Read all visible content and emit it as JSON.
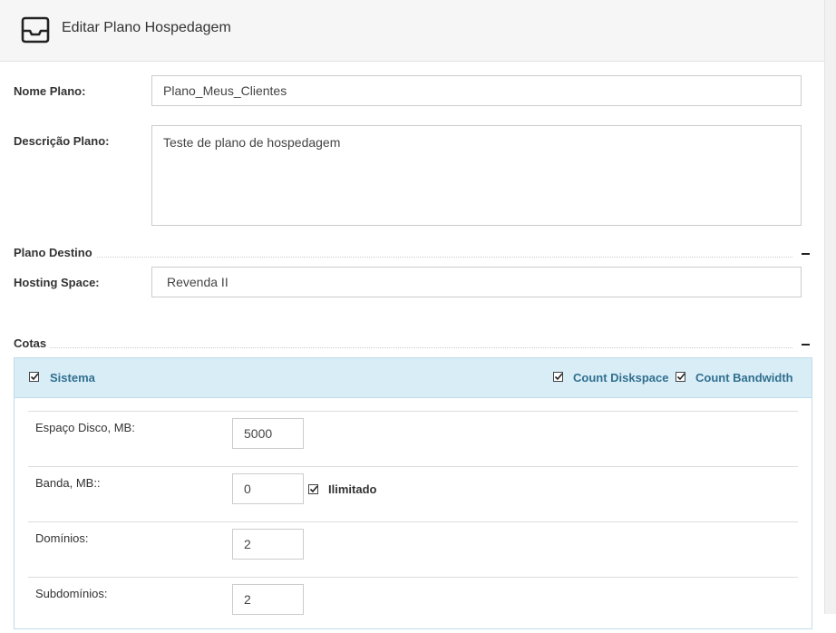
{
  "header": {
    "title": "Editar Plano Hospedagem",
    "icon": "inbox-icon"
  },
  "form": {
    "nome_label": "Nome Plano:",
    "nome_value": "Plano_Meus_Clientes",
    "descricao_label": "Descrição Plano:",
    "descricao_value": "Teste de plano de hospedagem",
    "plano_destino_title": "Plano Destino",
    "hosting_space_label": "Hosting Space:",
    "hosting_space_value": "Revenda II"
  },
  "cotas": {
    "title": "Cotas",
    "group": {
      "name": "Sistema",
      "checked": true,
      "count_diskspace_label": "Count Diskspace",
      "count_diskspace_checked": true,
      "count_bandwidth_label": "Count Bandwidth",
      "count_bandwidth_checked": true
    },
    "rows": [
      {
        "label": "Espaço Disco, MB:",
        "value": "5000"
      },
      {
        "label": "Banda, MB::",
        "value": "0",
        "unlimited_label": "Ilimitado",
        "unlimited_checked": true
      },
      {
        "label": "Domínios:",
        "value": "2"
      },
      {
        "label": "Subdomínios:",
        "value": "2"
      }
    ]
  },
  "colors": {
    "panel_header_bg": "#d9edf7",
    "panel_header_text": "#31708f"
  }
}
